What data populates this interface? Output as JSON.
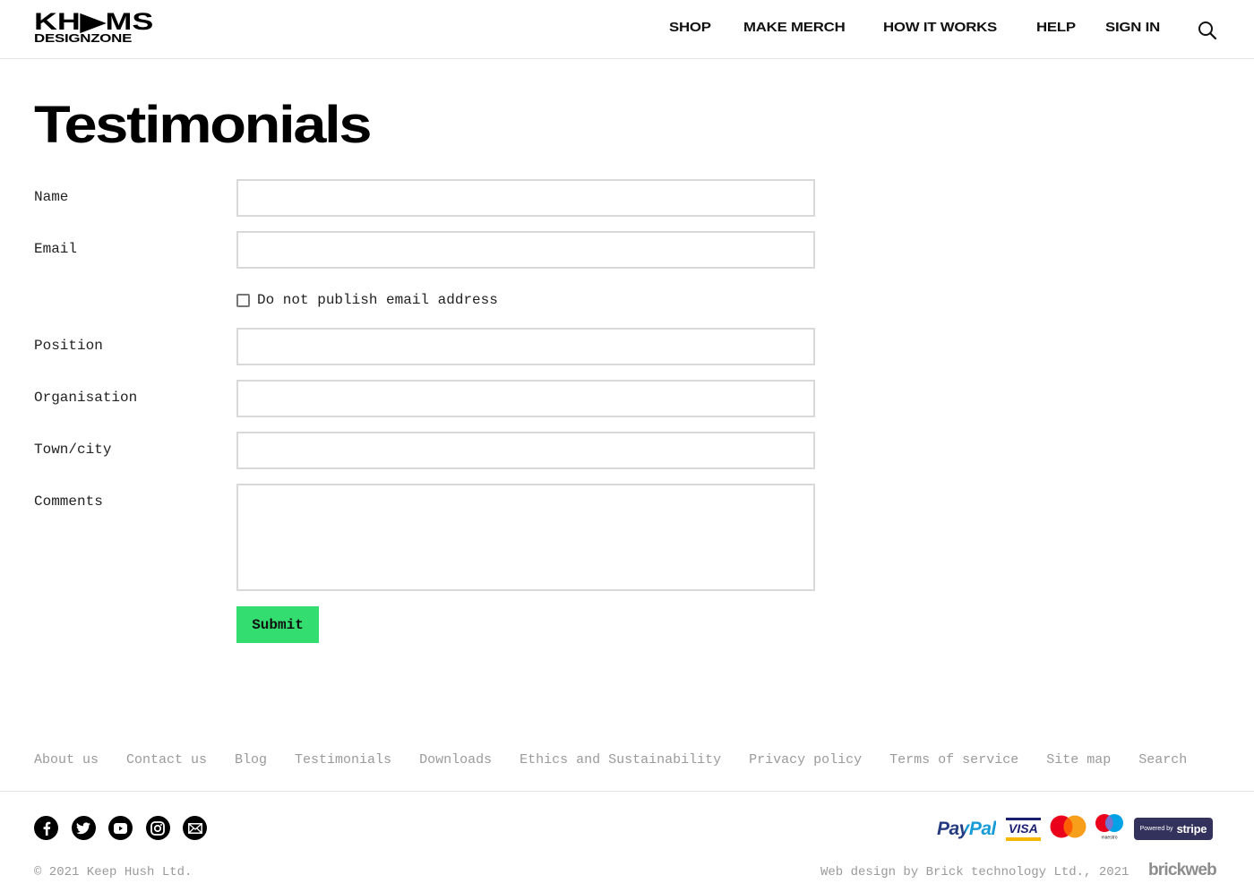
{
  "header": {
    "logo": {
      "line1": "KH▶MS",
      "line2": "DESIGNZONE"
    },
    "nav": [
      "SHOP",
      "MAKE MERCH",
      "HOW IT WORKS",
      "HELP",
      "SIGN IN"
    ],
    "search_icon": "search-icon"
  },
  "page": {
    "title": "Testimonials"
  },
  "form": {
    "fields": [
      {
        "label": "Name",
        "value": "",
        "placeholder": ""
      },
      {
        "label": "Email",
        "value": "",
        "placeholder": ""
      },
      {
        "label": "Position",
        "value": "",
        "placeholder": ""
      },
      {
        "label": "Organisation",
        "value": "",
        "placeholder": ""
      },
      {
        "label": "Town/city",
        "value": "",
        "placeholder": ""
      },
      {
        "label": "Comments",
        "value": "",
        "placeholder": ""
      }
    ],
    "checkbox": {
      "label": "Do not publish email address",
      "checked": false
    },
    "submit_label": "Submit",
    "submit_color": "#33dd6f"
  },
  "footer": {
    "links": [
      "About us",
      "Contact us",
      "Blog",
      "Testimonials",
      "Downloads",
      "Ethics and Sustainability",
      "Privacy policy",
      "Terms of service",
      "Site map",
      "Search"
    ],
    "social": [
      "facebook-icon",
      "twitter-icon",
      "youtube-icon",
      "instagram-icon",
      "email-icon"
    ],
    "payments": {
      "paypal": "PayPal",
      "visa": "VISA",
      "mastercard": "mastercard",
      "maestro": "maestro",
      "stripe_prefix": "Powered by",
      "stripe": "stripe"
    },
    "copyright": "© 2021 Keep Hush Ltd.",
    "credit": "Web design by Brick technology Ltd., 2021",
    "credit_brand": "brickweb"
  }
}
